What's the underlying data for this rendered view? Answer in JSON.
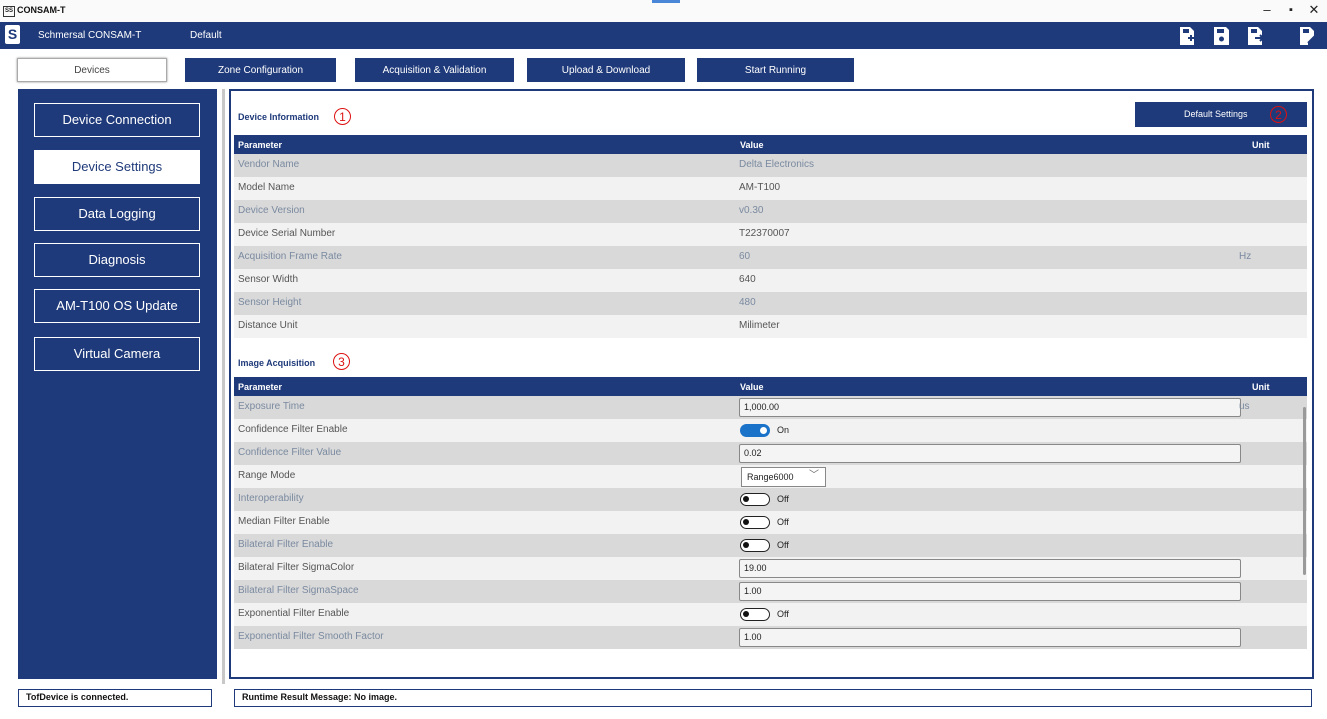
{
  "window": {
    "title": "CONSAM-T",
    "icon_label": "SS"
  },
  "appbar": {
    "logo": "S",
    "app_name": "Schmersal CONSAM-T",
    "profile": "Default",
    "toolbar_icons": [
      "new-file-icon",
      "save-icon",
      "import-icon",
      "export-icon"
    ]
  },
  "tabs": [
    {
      "label": "Devices",
      "active": true
    },
    {
      "label": "Zone Configuration",
      "active": false
    },
    {
      "label": "Acquisition & Validation",
      "active": false
    },
    {
      "label": "Upload & Download",
      "active": false
    },
    {
      "label": "Start Running",
      "active": false
    }
  ],
  "sidebar": {
    "items": [
      {
        "label": "Device Connection",
        "active": false
      },
      {
        "label": "Device Settings",
        "active": true
      },
      {
        "label": "Data Logging",
        "active": false
      },
      {
        "label": "Diagnosis",
        "active": false
      },
      {
        "label": "AM-T100 OS Update",
        "active": false
      },
      {
        "label": "Virtual Camera",
        "active": false
      }
    ]
  },
  "device_info": {
    "title": "Device Information",
    "callout": "1",
    "default_button": "Default Settings",
    "default_callout": "2",
    "headers": {
      "parameter": "Parameter",
      "value": "Value",
      "unit": "Unit"
    },
    "rows": [
      {
        "parameter": "Vendor Name",
        "value": "Delta Electronics",
        "unit": ""
      },
      {
        "parameter": "Model Name",
        "value": "AM-T100",
        "unit": ""
      },
      {
        "parameter": "Device Version",
        "value": "v0.30",
        "unit": ""
      },
      {
        "parameter": "Device Serial Number",
        "value": "T22370007",
        "unit": ""
      },
      {
        "parameter": "Acquisition Frame Rate",
        "value": "60",
        "unit": "Hz"
      },
      {
        "parameter": "Sensor Width",
        "value": "640",
        "unit": ""
      },
      {
        "parameter": "Sensor Height",
        "value": "480",
        "unit": ""
      },
      {
        "parameter": "Distance Unit",
        "value": "Milimeter",
        "unit": ""
      }
    ]
  },
  "image_acq": {
    "title": "Image Acquisition",
    "callout": "3",
    "headers": {
      "parameter": "Parameter",
      "value": "Value",
      "unit": "Unit"
    },
    "rows": [
      {
        "parameter": "Exposure Time",
        "type": "input",
        "value": "1,000.00",
        "unit": "us"
      },
      {
        "parameter": "Confidence Filter Enable",
        "type": "toggle",
        "on": true,
        "value": "On",
        "unit": ""
      },
      {
        "parameter": "Confidence Filter Value",
        "type": "input",
        "value": "0.02",
        "unit": ""
      },
      {
        "parameter": "Range Mode",
        "type": "select",
        "value": "Range6000",
        "unit": ""
      },
      {
        "parameter": "Interoperability",
        "type": "toggle",
        "on": false,
        "value": "Off",
        "unit": ""
      },
      {
        "parameter": "Median Filter Enable",
        "type": "toggle",
        "on": false,
        "value": "Off",
        "unit": ""
      },
      {
        "parameter": "Bilateral Filter Enable",
        "type": "toggle",
        "on": false,
        "value": "Off",
        "unit": ""
      },
      {
        "parameter": "Bilateral Filter SigmaColor",
        "type": "input",
        "value": "19.00",
        "unit": ""
      },
      {
        "parameter": "Bilateral Filter SigmaSpace",
        "type": "input",
        "value": "1.00",
        "unit": ""
      },
      {
        "parameter": "Exponential Filter Enable",
        "type": "toggle",
        "on": false,
        "value": "Off",
        "unit": ""
      },
      {
        "parameter": "Exponential Filter Smooth Factor",
        "type": "input",
        "value": "1.00",
        "unit": ""
      }
    ]
  },
  "status": {
    "left": "TofDevice is connected.",
    "right": "Runtime Result Message: No image."
  }
}
